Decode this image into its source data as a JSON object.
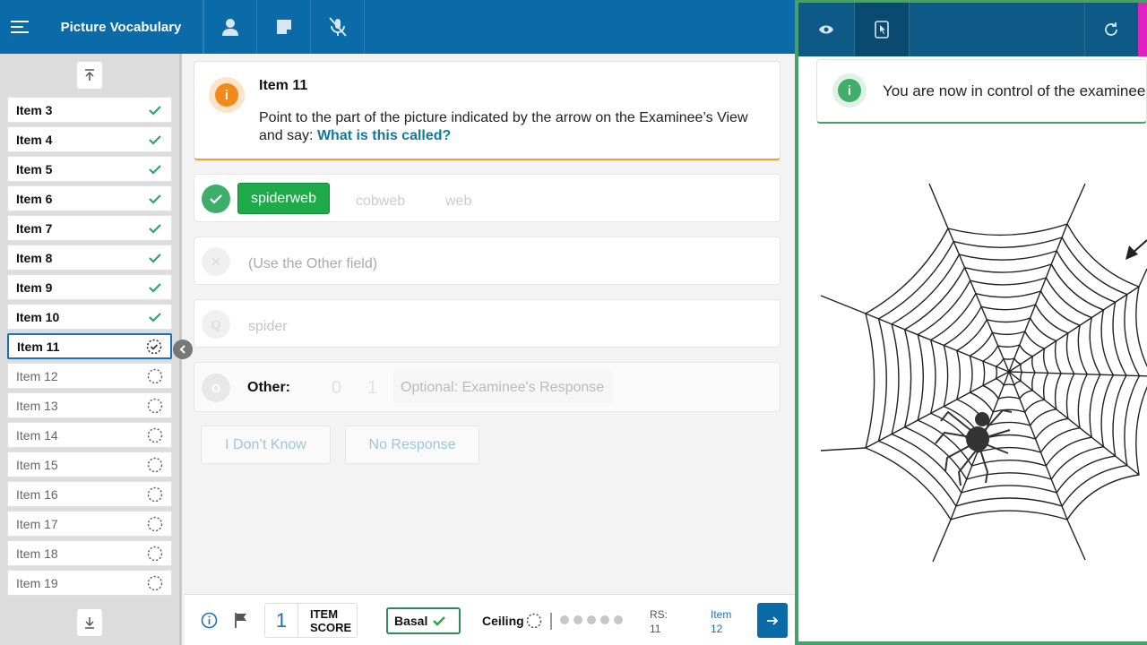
{
  "header": {
    "title": "Picture Vocabulary",
    "icons": [
      "menu-icon",
      "person-icon",
      "note-icon",
      "mic-off-icon"
    ]
  },
  "sidebar": {
    "items": [
      {
        "label": "Item 3",
        "status": "done"
      },
      {
        "label": "Item 4",
        "status": "done"
      },
      {
        "label": "Item 5",
        "status": "done"
      },
      {
        "label": "Item 6",
        "status": "done"
      },
      {
        "label": "Item 7",
        "status": "done"
      },
      {
        "label": "Item 8",
        "status": "done"
      },
      {
        "label": "Item 9",
        "status": "done"
      },
      {
        "label": "Item 10",
        "status": "done"
      },
      {
        "label": "Item 11",
        "status": "current"
      },
      {
        "label": "Item 12",
        "status": "todo"
      },
      {
        "label": "Item 13",
        "status": "todo"
      },
      {
        "label": "Item 14",
        "status": "todo"
      },
      {
        "label": "Item 15",
        "status": "todo"
      },
      {
        "label": "Item 16",
        "status": "todo"
      },
      {
        "label": "Item 17",
        "status": "todo"
      },
      {
        "label": "Item 18",
        "status": "todo"
      },
      {
        "label": "Item 19",
        "status": "todo"
      }
    ]
  },
  "item": {
    "title": "Item 11",
    "instruction": "Point to the part of the picture indicated by the arrow on the Examinee’s View and say: ",
    "prompt": "What is this called?"
  },
  "responses": {
    "correct": {
      "selected": "spiderweb",
      "alt1": "cobweb",
      "alt2": "web"
    },
    "incorrect": {
      "label": "(Use the Other field)"
    },
    "query": {
      "label": "spider",
      "badge": "Q"
    },
    "other": {
      "label": "Other:",
      "badge": "O",
      "score0": "0",
      "score1": "1",
      "placeholder": "Optional: Examinee's Response"
    }
  },
  "buttons": {
    "dont_know": "I Don’t Know",
    "no_response": "No Response"
  },
  "footer": {
    "item_score_value": "1",
    "item_score_label1": "ITEM",
    "item_score_label2": "SCORE",
    "basal": "Basal",
    "ceiling": "Ceiling",
    "rs_label": "RS:",
    "rs_value": "11",
    "next_label1": "Item",
    "next_label2": "12"
  },
  "examinee": {
    "notice": "You are now in control of the examinee",
    "icons": [
      "eye-icon",
      "tablet-pointer-icon",
      "refresh-icon"
    ]
  },
  "colors": {
    "primary": "#0b6aa8",
    "success": "#1faa4a",
    "warning": "#f28a1a",
    "right_border": "#4aa06a"
  }
}
